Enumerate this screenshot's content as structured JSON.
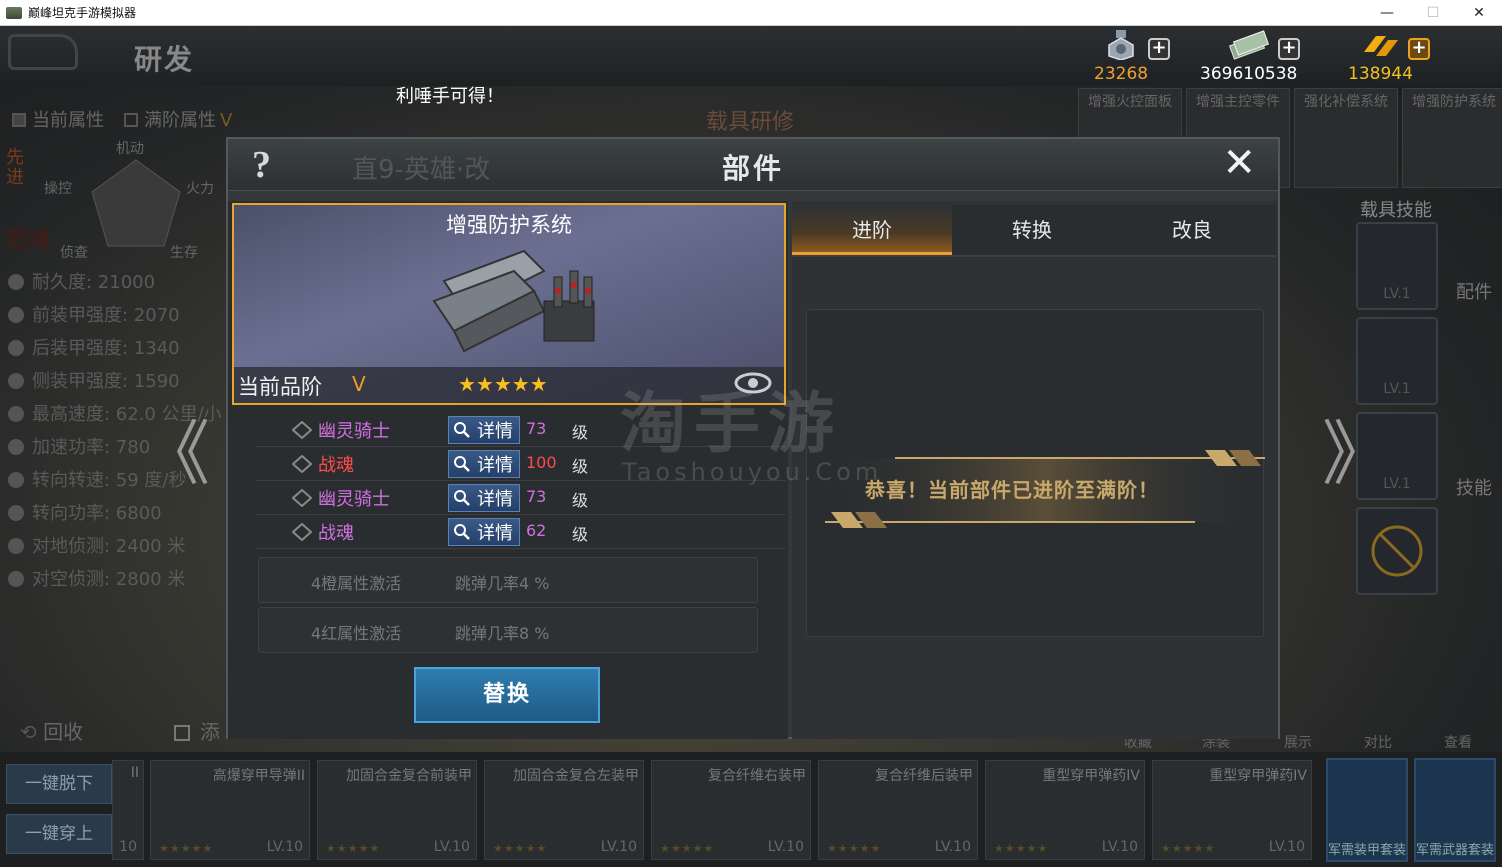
{
  "window": {
    "title": "巅峰坦克手游模拟器",
    "minimize": "—",
    "maximize": "☐",
    "close": "✕"
  },
  "topbar": {
    "page_title": "研发"
  },
  "currencies": [
    {
      "name": "medal",
      "value": "23268",
      "color": "#f0a030"
    },
    {
      "name": "cash",
      "value": "369610538",
      "color": "#ffffff"
    },
    {
      "name": "gold",
      "value": "138944",
      "color": "#f0c020"
    }
  ],
  "plus_label": "+",
  "marquee": "利唾手可得！",
  "background": {
    "attr_tabs": [
      "当前属性",
      "满阶属性"
    ],
    "attr_tab_suffix": "V",
    "radar_labels": [
      "机动",
      "操控",
      "火力",
      "侦查",
      "生存"
    ],
    "side_text_1": "先进",
    "side_text_2": "匠魂",
    "research_label": "载具研修",
    "stats": [
      "耐久度: 21000",
      "前装甲强度: 2070",
      "后装甲强度: 1340",
      "侧装甲强度: 1590",
      "最高速度: 62.0 公里/小",
      "加速功率: 780",
      "转向转速: 59 度/秒",
      "转向功率: 6800",
      "对地侦测: 2400 米",
      "对空侦测: 2800 米"
    ],
    "side_tabs": [
      "增强火控面板",
      "增强主控零件",
      "强化补偿系统",
      "增强防护系统"
    ],
    "skills_title": "载具技能",
    "skill_levels": [
      "LV.1",
      "LV.1",
      "LV.1"
    ],
    "right_labels": {
      "parts": "配件",
      "skills": "技能"
    },
    "bottom_actions": [
      "收藏",
      "涂装",
      "展示",
      "对比",
      "查看"
    ],
    "recycle": "回收",
    "recycle_suffix": "添",
    "take_off_all": "一键脱下",
    "put_on_all": "一键穿上",
    "bottom_cards": [
      {
        "name": "II",
        "level": "10",
        "stars": "★★★★★"
      },
      {
        "name": "高爆穿甲导弹II",
        "level": "LV.10",
        "stars": "★★★★★"
      },
      {
        "name": "加固合金复合前装甲",
        "level": "LV.10",
        "stars": "★★★★★"
      },
      {
        "name": "加固合金复合左装甲",
        "level": "LV.10",
        "stars": "★★★★★"
      },
      {
        "name": "复合纤维右装甲",
        "level": "LV.10",
        "stars": "★★★★★"
      },
      {
        "name": "复合纤维后装甲",
        "level": "LV.10",
        "stars": "★★★★★"
      },
      {
        "name": "重型穿甲弹药IV",
        "level": "LV.10",
        "stars": "★★★★★"
      },
      {
        "name": "重型穿甲弹药IV",
        "level": "LV.10",
        "stars": "★★★★★"
      }
    ],
    "suit_cards": [
      "军需装甲套装",
      "军需武器套装"
    ]
  },
  "modal": {
    "title": "部件",
    "help": "?",
    "close": "✕",
    "bg_subtitle": "直9-英雄·改",
    "part": {
      "name": "增强防护系统",
      "grade_label": "当前品阶",
      "grade_value": "V",
      "stars": "★★★★★"
    },
    "materials": [
      {
        "name": "幽灵骑士",
        "level": "73",
        "unit": "级",
        "name_color": "#d070e0",
        "level_color": "#d070e0"
      },
      {
        "name": "战魂",
        "level": "100",
        "unit": "级",
        "name_color": "#ff4a4a",
        "level_color": "#ff4a4a"
      },
      {
        "name": "幽灵骑士",
        "level": "73",
        "unit": "级",
        "name_color": "#d070e0",
        "level_color": "#d070e0"
      },
      {
        "name": "战魂",
        "level": "62",
        "unit": "级",
        "name_color": "#d070e0",
        "level_color": "#d070e0"
      }
    ],
    "detail_label": "详情",
    "attrs": [
      {
        "label": "4橙属性激活",
        "value": "跳弹几率4 %"
      },
      {
        "label": "4红属性激活",
        "value": "跳弹几率8 %"
      }
    ],
    "replace_button": "替换",
    "tabs": [
      "进阶",
      "转换",
      "改良"
    ],
    "active_tab": 0,
    "message": "恭喜！当前部件已进阶至满阶！"
  },
  "nav": {
    "prev": "《",
    "next": "》"
  },
  "watermark": {
    "cn": "淘手游",
    "en": "Taoshouyou.Com"
  }
}
